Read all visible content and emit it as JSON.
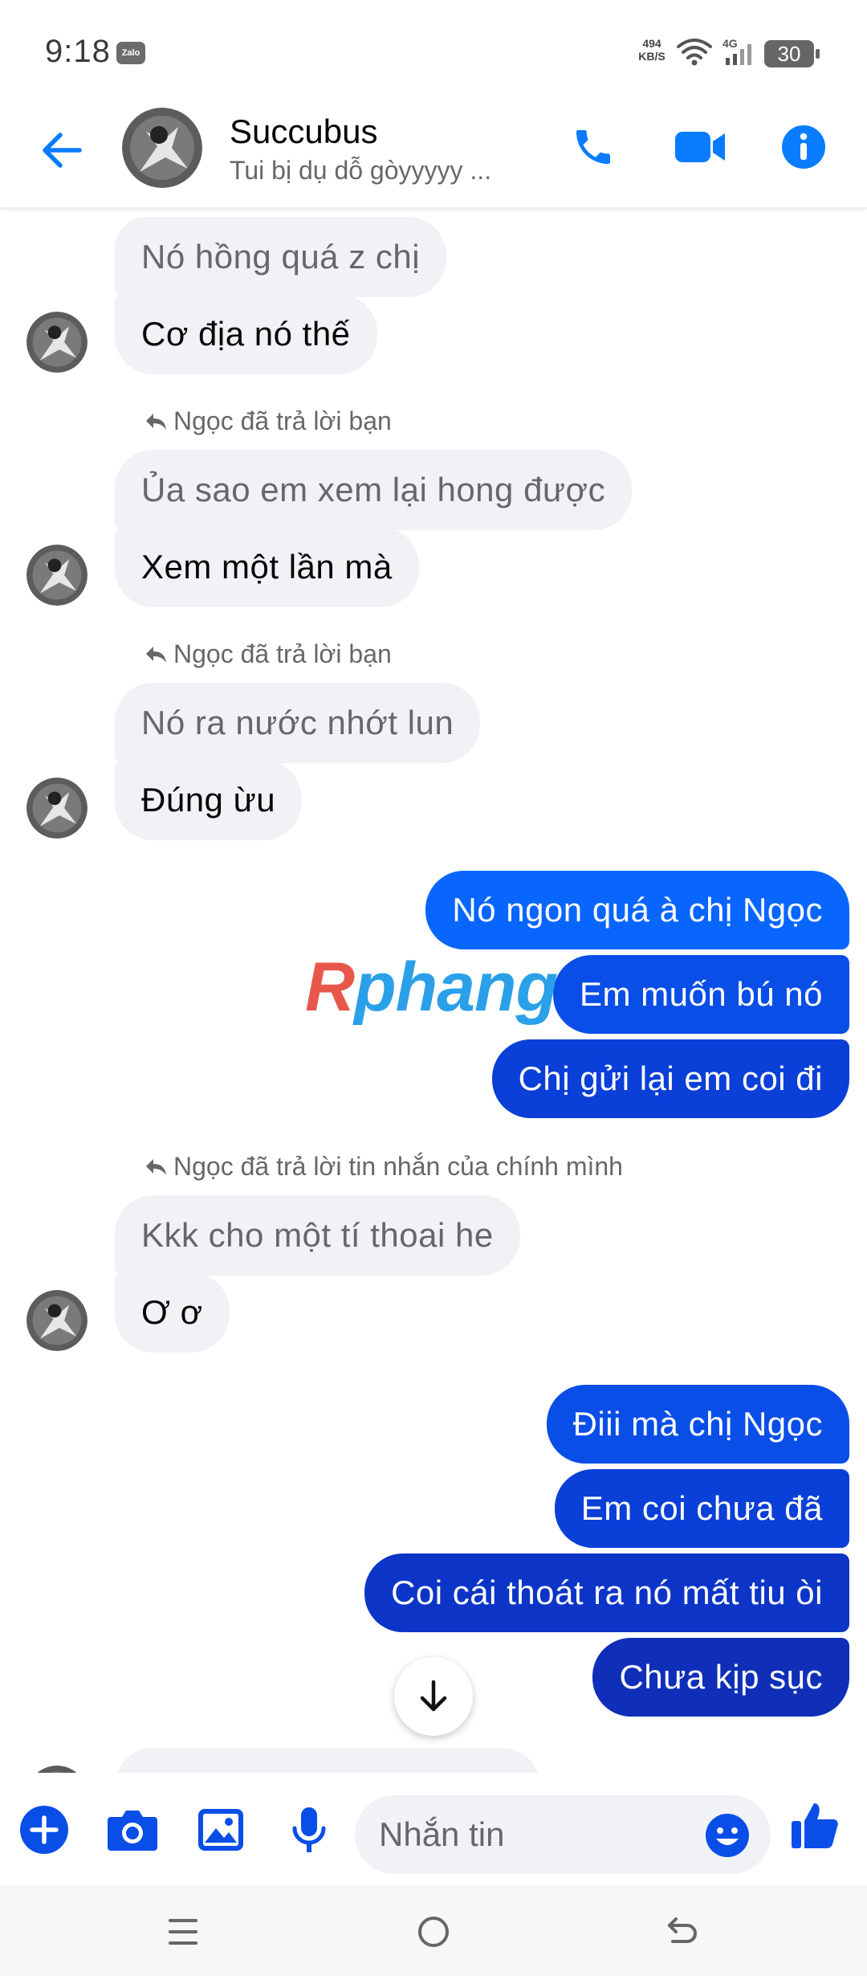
{
  "status_bar": {
    "time": "9:18",
    "zalo_badge": "Zalo",
    "net_speed_value": "494",
    "net_speed_unit": "KB/S",
    "network_type": "4G",
    "battery": "30"
  },
  "header": {
    "contact_name": "Succubus",
    "contact_status": "Tui bị dụ dỗ gòyyyyy ..."
  },
  "messages": {
    "m1_quoted": "Nó hồng quá z chị",
    "m1_reply": "Cơ địa nó thế",
    "note2": "Ngọc đã trả lời bạn",
    "m2_quoted": "Ủa sao em xem lại hong được",
    "m2_reply": "Xem một lần mà",
    "note3": "Ngọc đã trả lời bạn",
    "m3_quoted": "Nó ra nước nhớt lun",
    "m3_reply": "Đúng ừu",
    "s1": "Nó ngon quá à chị Ngọc",
    "s2": "Em muốn bú nó",
    "s3": "Chị gửi lại em coi đi",
    "note4": "Ngọc đã trả lời tin nhắn của chính mình",
    "m4_quoted": "Kkk cho một tí thoai he",
    "m4_reply": "Ơ ơ",
    "s4": "Điii mà chị Ngọc",
    "s5": "Em coi chưa đã",
    "s6": "Coi cái thoát ra nó mất tiu òi",
    "s7": "Chưa kịp sục"
  },
  "watermark": {
    "first": "R",
    "rest": "phang"
  },
  "composer": {
    "placeholder": "Nhắn tin"
  },
  "colors": {
    "accent": "#0a7cff",
    "sent_top": "#0866ff",
    "sent_mid": "#0a3fd8",
    "sent_bottom": "#0f2fb8",
    "received": "#f0f2f5"
  },
  "icons": {
    "back": "arrow-left-icon",
    "call": "phone-icon",
    "video": "video-camera-icon",
    "info": "info-icon",
    "add": "plus-circle-icon",
    "camera": "camera-icon",
    "gallery": "image-icon",
    "mic": "microphone-icon",
    "emoji": "smiley-icon",
    "like": "thumbs-up-icon",
    "scroll": "arrow-down-icon"
  }
}
